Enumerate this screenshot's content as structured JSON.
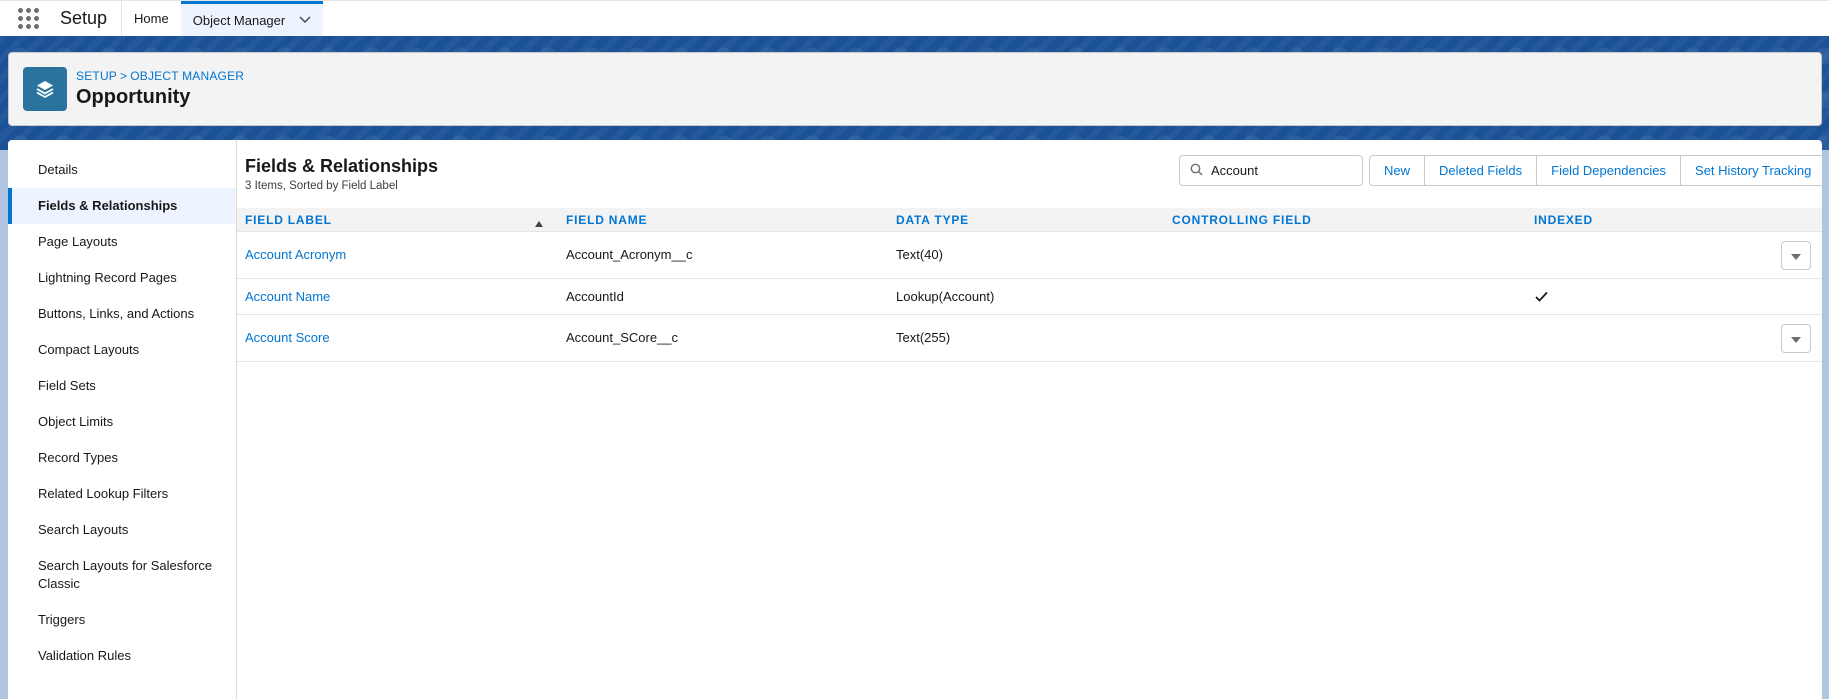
{
  "topnav": {
    "app_name": "Setup",
    "tabs": [
      {
        "label": "Home"
      },
      {
        "label": "Object Manager"
      }
    ]
  },
  "header": {
    "breadcrumb": [
      "SETUP",
      ">",
      "OBJECT MANAGER"
    ],
    "object_title": "Opportunity"
  },
  "sidebar": {
    "items": [
      {
        "label": "Details"
      },
      {
        "label": "Fields & Relationships",
        "active": true
      },
      {
        "label": "Page Layouts"
      },
      {
        "label": "Lightning Record Pages"
      },
      {
        "label": "Buttons, Links, and Actions"
      },
      {
        "label": "Compact Layouts"
      },
      {
        "label": "Field Sets"
      },
      {
        "label": "Object Limits"
      },
      {
        "label": "Record Types"
      },
      {
        "label": "Related Lookup Filters"
      },
      {
        "label": "Search Layouts"
      },
      {
        "label": "Search Layouts for Salesforce Classic"
      },
      {
        "label": "Triggers"
      },
      {
        "label": "Validation Rules"
      }
    ]
  },
  "main": {
    "title": "Fields & Relationships",
    "subtitle": "3 Items, Sorted by Field Label",
    "search": {
      "value": "Account"
    },
    "buttons": [
      "New",
      "Deleted Fields",
      "Field Dependencies",
      "Set History Tracking"
    ],
    "columns": [
      "FIELD LABEL",
      "FIELD NAME",
      "DATA TYPE",
      "CONTROLLING FIELD",
      "INDEXED"
    ],
    "rows": [
      {
        "field_label": "Account Acronym",
        "field_name": "Account_Acronym__c",
        "data_type": "Text(40)",
        "controlling_field": "",
        "indexed": false,
        "has_menu": true
      },
      {
        "field_label": "Account Name",
        "field_name": "AccountId",
        "data_type": "Lookup(Account)",
        "controlling_field": "",
        "indexed": true,
        "has_menu": false
      },
      {
        "field_label": "Account Score",
        "field_name": "Account_SCore__c",
        "data_type": "Text(255)",
        "controlling_field": "",
        "indexed": false,
        "has_menu": true
      }
    ]
  },
  "icons": {
    "app_launcher": "app-launcher-icon",
    "object": "layers-icon",
    "search": "search-icon",
    "sort": "sort-ascending-icon",
    "indexed": "checkmark-icon",
    "row_menu": "chevron-down-icon"
  },
  "colors": {
    "brand_blue": "#0176d3",
    "banner": "#1b5297",
    "object_icon": "#2a739e"
  }
}
